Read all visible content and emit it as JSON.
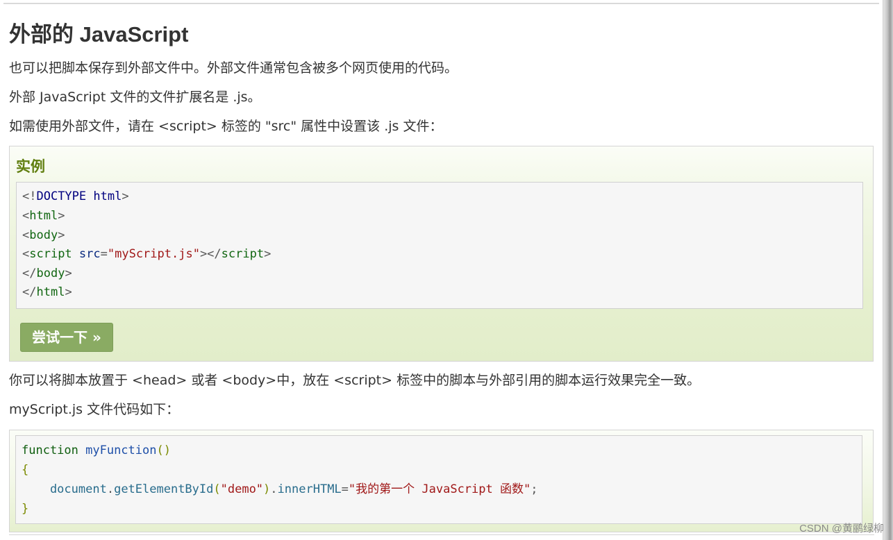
{
  "heading": "外部的 JavaScript",
  "paragraphs": {
    "p1": "也可以把脚本保存到外部文件中。外部文件通常包含被多个网页使用的代码。",
    "p2": "外部 JavaScript 文件的文件扩展名是 .js。",
    "p3": "如需使用外部文件，请在 <script> 标签的 \"src\" 属性中设置该 .js 文件：",
    "p4": "你可以将脚本放置于 <head> 或者 <body>中，放在 <script> 标签中的脚本与外部引用的脚本运行效果完全一致。",
    "p5": "myScript.js 文件代码如下："
  },
  "example": {
    "title": "实例",
    "try_button": "尝试一下 »",
    "code": {
      "l1_a": "<!",
      "l1_b": "DOCTYPE",
      "l1_c": " html",
      "l1_d": ">",
      "l2_a": "<",
      "l2_b": "html",
      "l2_c": ">",
      "l3_a": "<",
      "l3_b": "body",
      "l3_c": ">",
      "l4_a": "<",
      "l4_b": "script",
      "l4_c": " src",
      "l4_d": "=",
      "l4_e": "\"myScript.js\"",
      "l4_f": "></",
      "l4_g": "script",
      "l4_h": ">",
      "l5_a": "</",
      "l5_b": "body",
      "l5_c": ">",
      "l6_a": "</",
      "l6_b": "html",
      "l6_c": ">"
    }
  },
  "js_code": {
    "l1_a": "function",
    "l1_b": " myFunction",
    "l1_c": "()",
    "l2": "{",
    "l3_a": "    document",
    "l3_b": ".",
    "l3_c": "getElementById",
    "l3_d": "(",
    "l3_e": "\"demo\"",
    "l3_f": ")",
    "l3_g": ".",
    "l3_h": "innerHTML",
    "l3_i": "=",
    "l3_j": "\"我的第一个 JavaScript 函数\"",
    "l3_k": ";",
    "l4": "}"
  },
  "watermark": "CSDN @黄鹂绿柳",
  "colors": {
    "example_title": "#617f10",
    "button_bg": "#8aab63",
    "example_bg": "#e6f0cf"
  }
}
